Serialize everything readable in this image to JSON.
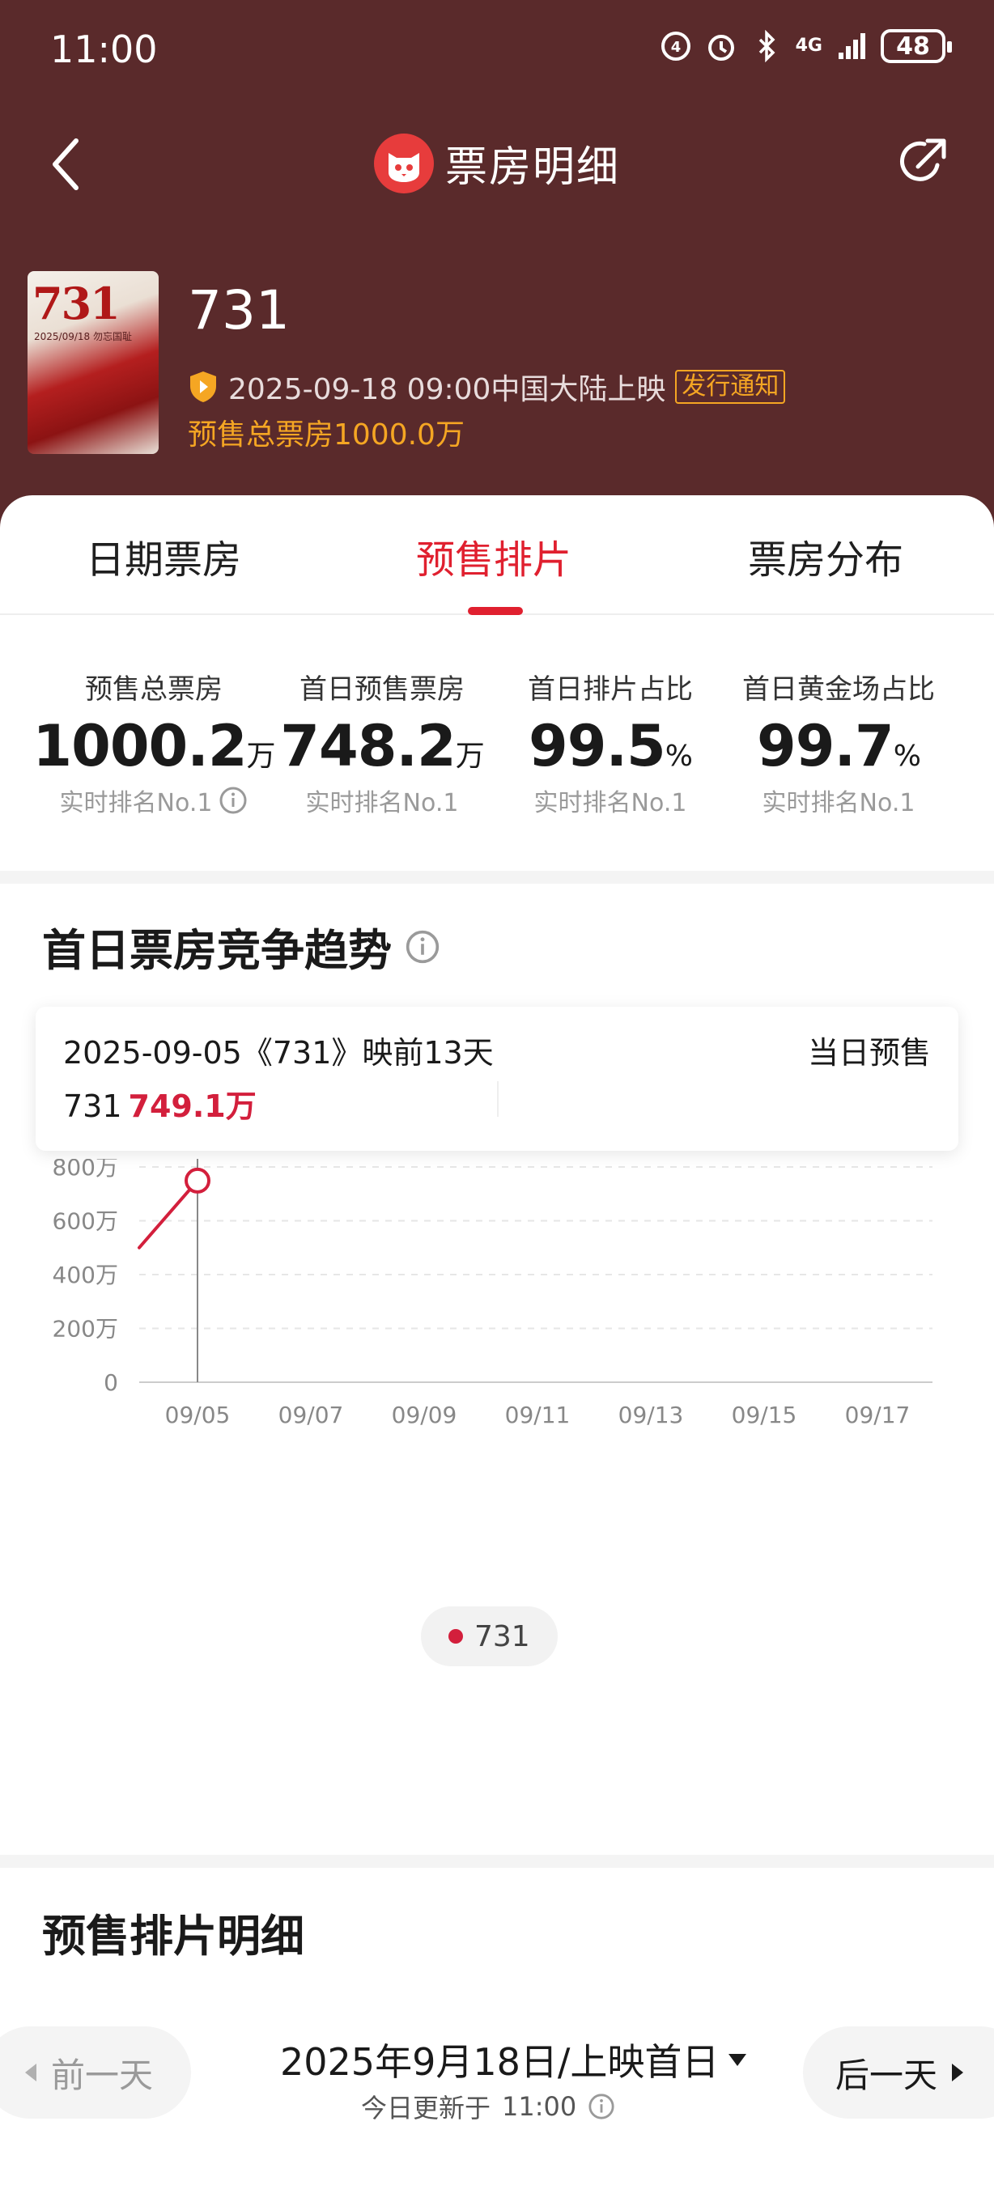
{
  "status_bar": {
    "time": "11:00",
    "network": "4G",
    "battery": "48"
  },
  "nav": {
    "title": "票房明细"
  },
  "movie": {
    "poster_title": "731",
    "poster_sub": "2025/09/18 勿忘国耻",
    "title": "731",
    "release": "2025-09-18 09:00中国大陆上映",
    "notice_badge": "发行通知",
    "presale_total": "预售总票房1000.0万"
  },
  "tabs": [
    {
      "label": "日期票房",
      "active": false
    },
    {
      "label": "预售排片",
      "active": true
    },
    {
      "label": "票房分布",
      "active": false
    }
  ],
  "stats": [
    {
      "label": "预售总票房",
      "value": "1000.2",
      "unit": "万",
      "rank": "实时排名No.1"
    },
    {
      "label": "首日预售票房",
      "value": "748.2",
      "unit": "万",
      "rank": "实时排名No.1"
    },
    {
      "label": "首日排片占比",
      "value": "99.5",
      "unit": "%",
      "rank": "实时排名No.1"
    },
    {
      "label": "首日黄金场占比",
      "value": "99.7",
      "unit": "%",
      "rank": "实时排名No.1"
    }
  ],
  "trend": {
    "title": "首日票房竞争趋势",
    "tooltip": {
      "date": "2025-09-05《731》映前13天",
      "type": "当日预售",
      "series": "731",
      "value": "749.1万"
    },
    "legend": "731"
  },
  "chart_data": {
    "type": "line",
    "x": [
      "09/04",
      "09/05"
    ],
    "series": [
      {
        "name": "731",
        "values": [
          500,
          749.1
        ]
      }
    ],
    "x_ticks": [
      "09/05",
      "09/07",
      "09/09",
      "09/11",
      "09/13",
      "09/15",
      "09/17"
    ],
    "y_ticks": [
      "0",
      "200万",
      "400万",
      "600万",
      "800万"
    ],
    "ylim": [
      0,
      800
    ],
    "highlight": {
      "x": "09/05",
      "value": 749.1
    },
    "grid": true,
    "colors": {
      "line": "#d31f3c",
      "grid": "#e6e6e6"
    }
  },
  "schedule": {
    "title": "预售排片明细",
    "prev_label": "前一天",
    "next_label": "后一天",
    "date_label": "2025年9月18日/上映首日",
    "updated": "今日更新于",
    "updated_time": "11:00"
  }
}
